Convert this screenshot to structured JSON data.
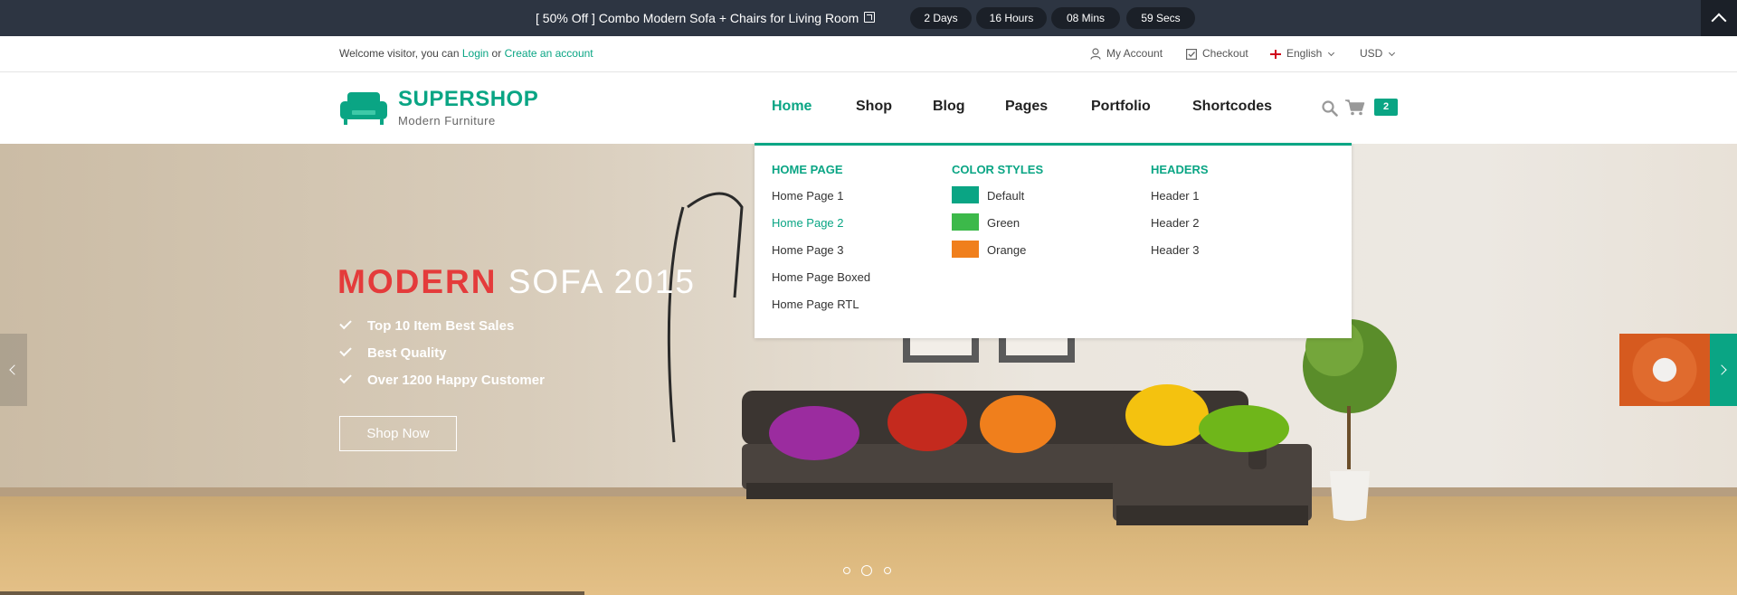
{
  "promo": {
    "text": "[ 50% Off ] Combo Modern Sofa + Chairs for Living Room",
    "countdown": [
      "2 Days",
      "16 Hours",
      "08 Mins",
      "59 Secs"
    ]
  },
  "toplinks": {
    "welcome_prefix": "Welcome visitor, you can ",
    "login": "Login",
    "or": " or ",
    "create_account": "Create an account",
    "my_account": "My Account",
    "checkout": "Checkout",
    "language": "English",
    "currency": "USD"
  },
  "header": {
    "brand": "SUPERSHOP",
    "tagline": "Modern Furniture",
    "nav": [
      "Home",
      "Shop",
      "Blog",
      "Pages",
      "Portfolio",
      "Shortcodes"
    ],
    "cart_count": "2"
  },
  "megamenu": {
    "col1": {
      "title": "HOME PAGE",
      "links": [
        "Home Page 1",
        "Home Page 2",
        "Home Page 3",
        "Home Page Boxed",
        "Home Page RTL"
      ]
    },
    "col2": {
      "title": "COLOR STYLES",
      "links": [
        "Default",
        "Green",
        "Orange"
      ],
      "colors": [
        "#0aa584",
        "#3cb94a",
        "#f07f1c"
      ]
    },
    "col3": {
      "title": "HEADERS",
      "links": [
        "Header 1",
        "Header 2",
        "Header 3"
      ]
    }
  },
  "hero": {
    "title_highlight": "MODERN",
    "title_rest": " SOFA 2015",
    "features": [
      "Top 10 Item Best Sales",
      "Best Quality",
      "Over 1200 Happy Customer"
    ],
    "button": "Shop Now"
  },
  "colors": {
    "accent": "#0aa584",
    "dark": "#2d3542",
    "highlight": "#e43b3b"
  }
}
